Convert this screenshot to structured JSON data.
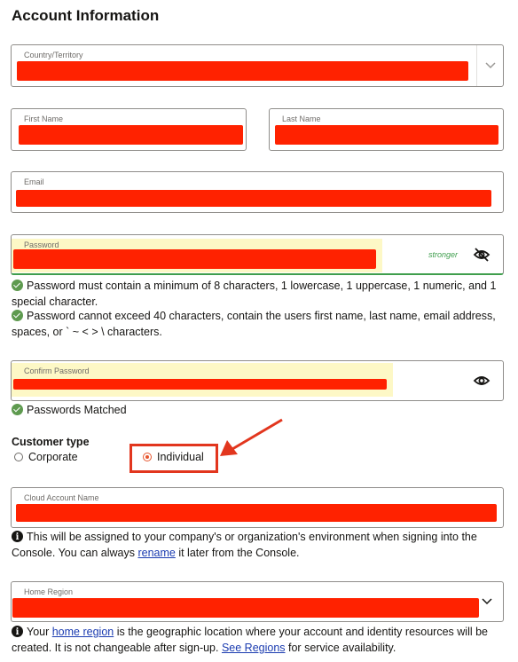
{
  "section_title": "Account Information",
  "fields": {
    "country": {
      "label": "Country/Territory"
    },
    "first_name": {
      "label": "First Name"
    },
    "last_name": {
      "label": "Last Name"
    },
    "email": {
      "label": "Email"
    },
    "password": {
      "label": "Password",
      "strength": "stronger"
    },
    "confirm_password": {
      "label": "Confirm Password"
    },
    "cloud_account_name": {
      "label": "Cloud Account Name"
    },
    "home_region": {
      "label": "Home Region"
    }
  },
  "password_rules": [
    "Password must contain a minimum of 8 characters, 1 lowercase, 1 uppercase, 1 numeric, and 1 special character.",
    "Password cannot exceed 40 characters, contain the users first name, last name, email address, spaces, or ` ~ < > \\ characters."
  ],
  "passwords_matched": "Passwords Matched",
  "customer_type": {
    "label": "Customer type",
    "options": [
      "Corporate",
      "Individual"
    ],
    "selected": "Individual"
  },
  "cloud_account_help": {
    "before": "This will be assigned to your company's or organization's environment when signing into the Console. You can always ",
    "link": "rename",
    "after": " it later from the Console."
  },
  "home_region_help": {
    "before": "Your ",
    "link1": "home region",
    "middle": " is the geographic location where your account and identity resources will be created. It is not changeable after sign-up. ",
    "link2": "See Regions",
    "after": " for service availability."
  },
  "colors": {
    "redaction": "#ff2200",
    "success": "#5e9a4f",
    "link": "#1a3bb0",
    "callout": "#e2361e",
    "autofill_highlight": "#fdf8c6"
  }
}
